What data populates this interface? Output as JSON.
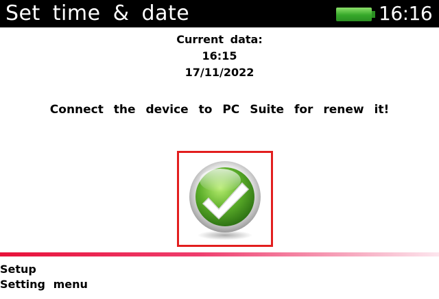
{
  "header": {
    "title": "Set time & date",
    "time": "16:16",
    "battery_icon": "battery-full-icon",
    "battery_color": "#3cb02e"
  },
  "info": {
    "label": "Current data:",
    "time": "16:15",
    "date": "17/11/2022"
  },
  "notice": "Connect the device to PC Suite for renew it!",
  "confirm": {
    "icon": "check-icon",
    "border_color": "#e21e1e"
  },
  "footer": {
    "line1": "Setup",
    "line2": "Setting menu"
  }
}
